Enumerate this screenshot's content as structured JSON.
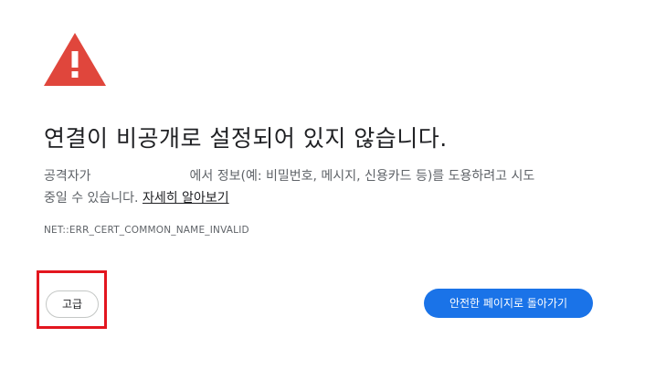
{
  "page": {
    "heading": "연결이 비공개로 설정되어 있지 않습니다.",
    "body_prefix": "공격자가",
    "body_line1_rest": "에서 정보(예: 비밀번호, 메시지, 신용카드 등)를 도용하려고 시도",
    "body_line2": "중일 수 있습니다. ",
    "learn_more_label": "자세히 알아보기",
    "error_code": "NET::ERR_CERT_COMMON_NAME_INVALID"
  },
  "buttons": {
    "advanced_label": "고급",
    "back_to_safety_label": "안전한 페이지로 돌아가기"
  },
  "colors": {
    "warning_red": "#e0463c",
    "primary_blue": "#1a73e8",
    "highlight_red": "#e3161f"
  },
  "icons": {
    "warning": "warning-triangle-icon"
  }
}
